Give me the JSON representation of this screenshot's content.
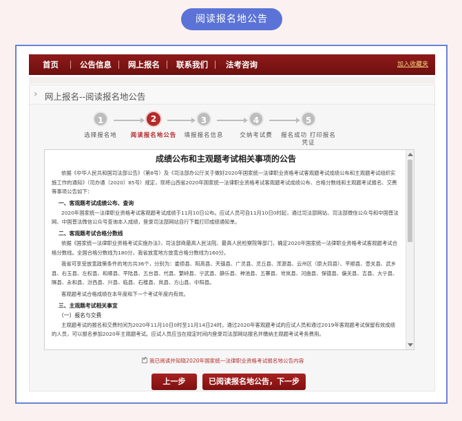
{
  "top_pill": "阅读报名地公告",
  "nav": {
    "items": [
      "首页",
      "公告信息",
      "网上报名",
      "联系我们",
      "法考咨询"
    ],
    "favorite": "加入收藏夹"
  },
  "breadcrumb": "网上报名--阅读报名地公告",
  "steps": [
    {
      "num": "1",
      "label": "选择报名地"
    },
    {
      "num": "2",
      "label": "阅读报名地公告"
    },
    {
      "num": "3",
      "label": "填报报名信息"
    },
    {
      "num": "4",
      "label": "交纳考试费"
    },
    {
      "num": "5",
      "label": "报名成功 打印报名凭证"
    }
  ],
  "announcement": {
    "title": "成绩公布和主观题考试相关事项的公告",
    "paras": [
      "依据《中华人民共和国司法部公告》（第8号）及《司法部办公厅关于做好2020年国家统一法律职业资格考试客观题考试成绩公布和主观题考试组织实施工作的通知》（司办通〔2020〕85号）规定，现将山西省2020年国家统一法律职业资格考试客观题考试成绩公布、合格分数线和主观题考试报名、交费等事项公告如下："
    ],
    "h1": "一、客观题考试成绩公布、查询",
    "p1": "2020年国家统一法律职业资格考试客观题考试成绩于11月10日公布。应试人员可自11月10日0时起，通过司法部网站、司法部微信公众号和中国普法网、中国普法微信公众号查询本人成绩，登录司法部网站自行下载打印成绩通知单。",
    "h2": "二、客观题考试合格分数线",
    "p2": "依据《国家统一法律职业资格考试实施办法》，司法部商最高人民法院、最高人民检察院等部门，确定2020年国家统一法律职业资格考试客观题考试合格分数线。全国合格分数线为180分，我省放宽地方放宽合格分数线为160分。",
    "p3": "我省可享受放宽政策条件的地方共36个，分别为：娄烦县、阳高县、天镇县、广灵县、灵丘县、浑源县、云州区（原大同县）、平顺县、壶关县、武乡县、右玉县、左权县、和顺县、平陆县、五台县、代县、繁峙县、宁武县、静乐县、神池县、五寨县、岢岚县、河曲县、保德县、偏关县、吉县、大宁县、隰县、永和县、汾西县、兴县、临县、石楼县、岚县、方山县、中阳县。",
    "p4": "客观题考试合格成绩在本年度和下一个考试年度内有效。",
    "h3": "三、主观题考试相关事宜",
    "h3a": "（一）报名与交费",
    "p5": "主观题考试的报名和交费时间为2020年11月10日0时至11月14日24时。通过2020年客观题考试的应试人员和通过2019年客观题考试保留有效成绩的人员，可以报名参加2020年主观题考试。应试人员应当在规定时间内登录司法部网站报名并缴纳主观题考试考务费用。"
  },
  "agree_text": "我已阅读并知晓2020年国家统一法律职业资格考试报名地公告内容",
  "buttons": {
    "prev": "上一步",
    "next": "已阅读报名地公告，下一步"
  }
}
